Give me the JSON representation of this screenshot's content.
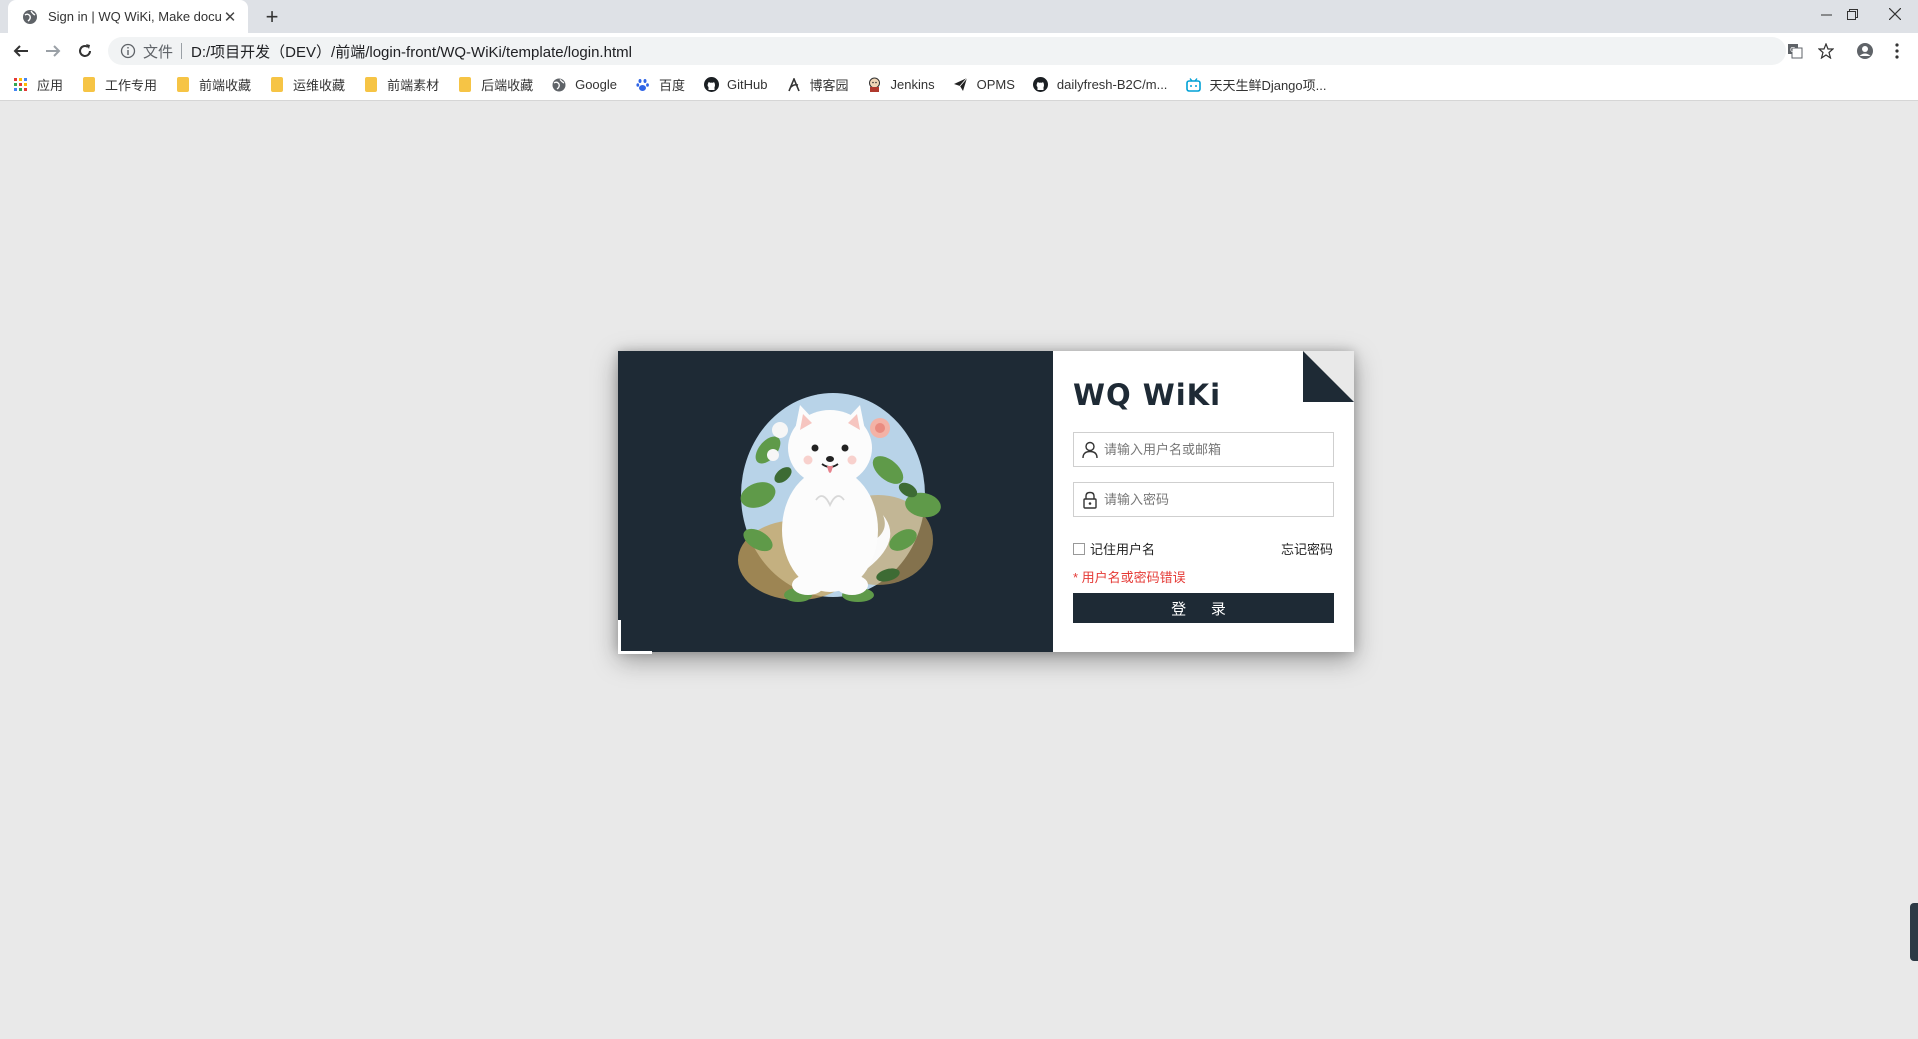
{
  "browser": {
    "tab_title": "Sign in | WQ WiKi, Make docum",
    "url_protocol": "文件",
    "url": "D:/项目开发（DEV）/前端/login-front/WQ-WiKi/template/login.html"
  },
  "bookmarks": [
    {
      "label": "应用",
      "icon": "apps-grid-icon"
    },
    {
      "label": "工作专用",
      "icon": "folder-icon"
    },
    {
      "label": "前端收藏",
      "icon": "folder-icon"
    },
    {
      "label": "运维收藏",
      "icon": "folder-icon"
    },
    {
      "label": "前端素材",
      "icon": "folder-icon"
    },
    {
      "label": "后端收藏",
      "icon": "folder-icon"
    },
    {
      "label": "Google",
      "icon": "globe-icon"
    },
    {
      "label": "百度",
      "icon": "baidu-paw-icon"
    },
    {
      "label": "GitHub",
      "icon": "github-icon"
    },
    {
      "label": "博客园",
      "icon": "cnblogs-icon"
    },
    {
      "label": "Jenkins",
      "icon": "jenkins-icon"
    },
    {
      "label": "OPMS",
      "icon": "paper-plane-icon"
    },
    {
      "label": "dailyfresh-B2C/m...",
      "icon": "github-icon"
    },
    {
      "label": "天天生鲜Django项...",
      "icon": "bilibili-icon"
    }
  ],
  "login": {
    "brand": "WQ WiKi",
    "username_placeholder": "请输入用户名或邮箱",
    "password_placeholder": "请输入密码",
    "remember_label": "记住用户名",
    "forgot_label": "忘记密码",
    "error_message": "* 用户名或密码错误",
    "submit_label": "登 录"
  },
  "colors": {
    "card_dark": "#1e2a35",
    "page_bg": "#e9e9e9",
    "error": "#e53935"
  }
}
